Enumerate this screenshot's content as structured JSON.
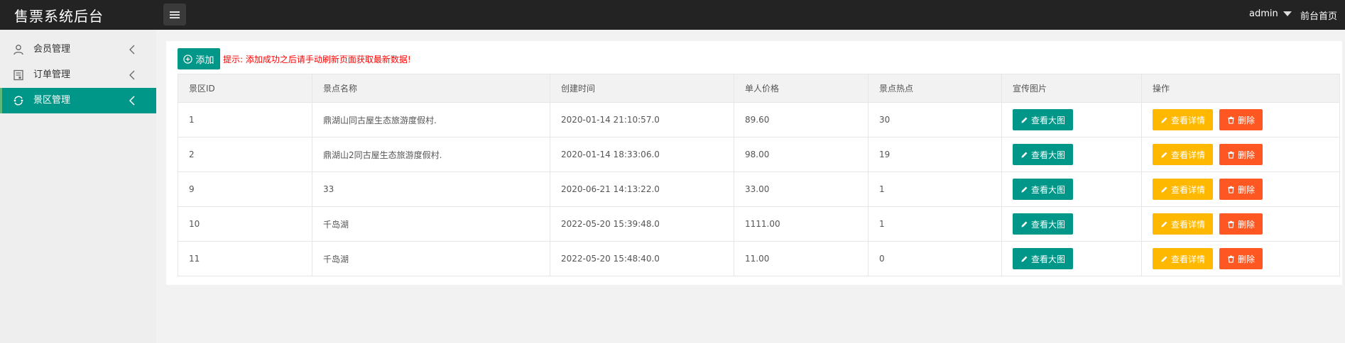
{
  "header": {
    "app_title": "售票系统后台",
    "user_label": "admin",
    "front_home_label": "前台首页"
  },
  "sidebar": {
    "items": [
      {
        "label": "会员管理",
        "icon": "user-icon",
        "active": false
      },
      {
        "label": "订单管理",
        "icon": "order-icon",
        "active": false
      },
      {
        "label": "景区管理",
        "icon": "scenic-icon",
        "active": true
      }
    ]
  },
  "toolbar": {
    "add_label": "添加",
    "hint": "提示: 添加成功之后请手动刷新页面获取最新数据!"
  },
  "table": {
    "columns": [
      "景区ID",
      "景点名称",
      "创建时间",
      "单人价格",
      "景点热点",
      "宣传图片",
      "操作"
    ],
    "rows": [
      {
        "id": "1",
        "name": "鼎湖山同古屋生态旅游度假村.",
        "created": "2020-01-14 21:10:57.0",
        "price": "89.60",
        "hot": "30"
      },
      {
        "id": "2",
        "name": "鼎湖山2同古屋生态旅游度假村.",
        "created": "2020-01-14 18:33:06.0",
        "price": "98.00",
        "hot": "19"
      },
      {
        "id": "9",
        "name": "33",
        "created": "2020-06-21 14:13:22.0",
        "price": "33.00",
        "hot": "1"
      },
      {
        "id": "10",
        "name": "千岛湖",
        "created": "2022-05-20 15:39:48.0",
        "price": "1111.00",
        "hot": "1"
      },
      {
        "id": "11",
        "name": "千岛湖",
        "created": "2022-05-20 15:48:40.0",
        "price": "11.00",
        "hot": "0"
      }
    ],
    "view_image_label": "查看大图",
    "view_detail_label": "查看详情",
    "delete_label": "删除"
  },
  "colors": {
    "header_bg": "#232323",
    "accent": "#009688",
    "warning": "#ffb800",
    "danger": "#ff5722",
    "hint": "#ff0000"
  }
}
